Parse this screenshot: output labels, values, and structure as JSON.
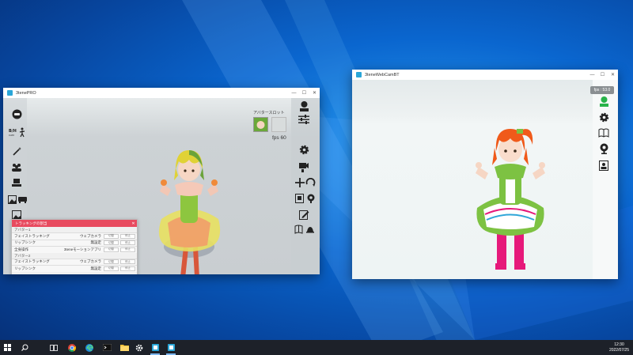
{
  "desktop": {
    "wallpaper": "windows-10-blue"
  },
  "pro_window": {
    "title": "3tenePRO",
    "avatar_slot_label": "アバタースロット",
    "fps": "fps  60",
    "tracking_panel": {
      "title": "トラッキングの割当",
      "groups": [
        {
          "label": "アバター1",
          "rows": [
            {
              "name": "フェイストラッキング",
              "source": "ウェブカメラ",
              "btn1": "切替",
              "btn2": "停止"
            },
            {
              "name": "リップシンク",
              "source": "無設定",
              "btn1": "切替",
              "btn2": "停止"
            },
            {
              "name": "全身操作",
              "source": "3teneモーションアプリ",
              "btn1": "切替",
              "btn2": "停止"
            }
          ]
        },
        {
          "label": "アバター2",
          "rows": [
            {
              "name": "フェイストラッキング",
              "source": "ウェブカメラ",
              "btn1": "切替",
              "btn2": "停止"
            },
            {
              "name": "リップシンク",
              "source": "無設定",
              "btn1": "切替",
              "btn2": "停止"
            }
          ]
        }
      ]
    }
  },
  "webcam_window": {
    "title": "3teneWebCamBT",
    "fps": "fps : 53.0"
  },
  "taskbar": {
    "time": "12:30",
    "date": "2022/07/25"
  },
  "colors": {
    "accent": "#e84a5f",
    "taskbar": "#1d2129",
    "app_icon": "#2aa6d8"
  }
}
